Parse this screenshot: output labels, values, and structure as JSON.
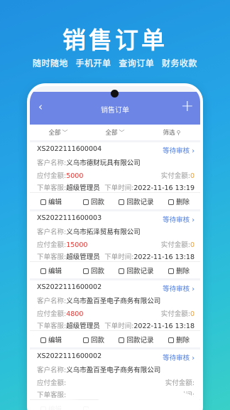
{
  "hero": {
    "title": "销售订单",
    "features": [
      "随时随地",
      "手机开单",
      "查询订单",
      "财务收款"
    ]
  },
  "navbar": {
    "back_icon": "‹",
    "title": "销售订单",
    "add_icon": "+"
  },
  "filters": {
    "a": "全部",
    "b": "全部",
    "c": "筛选"
  },
  "labels": {
    "customer": "客户名称:",
    "receivable": "应付金额:",
    "paid": "实付金额:",
    "staff": "下单客服:",
    "time": "下单时间:"
  },
  "actions": {
    "edit": "编辑",
    "collect": "回款",
    "record": "回款记录",
    "delete": "删除"
  },
  "orders": [
    {
      "no": "XS2022111600004",
      "status": "等待审核",
      "customer": "义乌市德财玩具有限公司",
      "amount": "5000",
      "paid": "0",
      "staff": "超级管理员",
      "time": "2022-11-16 13:19"
    },
    {
      "no": "XS2022111600003",
      "status": "等待审核",
      "customer": "义乌市拓泽贸易有限公司",
      "amount": "15000",
      "paid": "0",
      "staff": "超级管理员",
      "time": "2022-11-16 13:18"
    },
    {
      "no": "XS2022111600002",
      "status": "等待审核",
      "customer": "义乌市盈百圣电子商务有限公司",
      "amount": "4800",
      "paid": "0",
      "staff": "超级管理员",
      "time": "2022-11-16 13:18"
    },
    {
      "no": "XS2022111600002",
      "status": "等待审核",
      "customer": "义乌市盈百圣电子商务有限公司",
      "amount": "",
      "paid": "",
      "staff": "",
      "time": ""
    }
  ]
}
